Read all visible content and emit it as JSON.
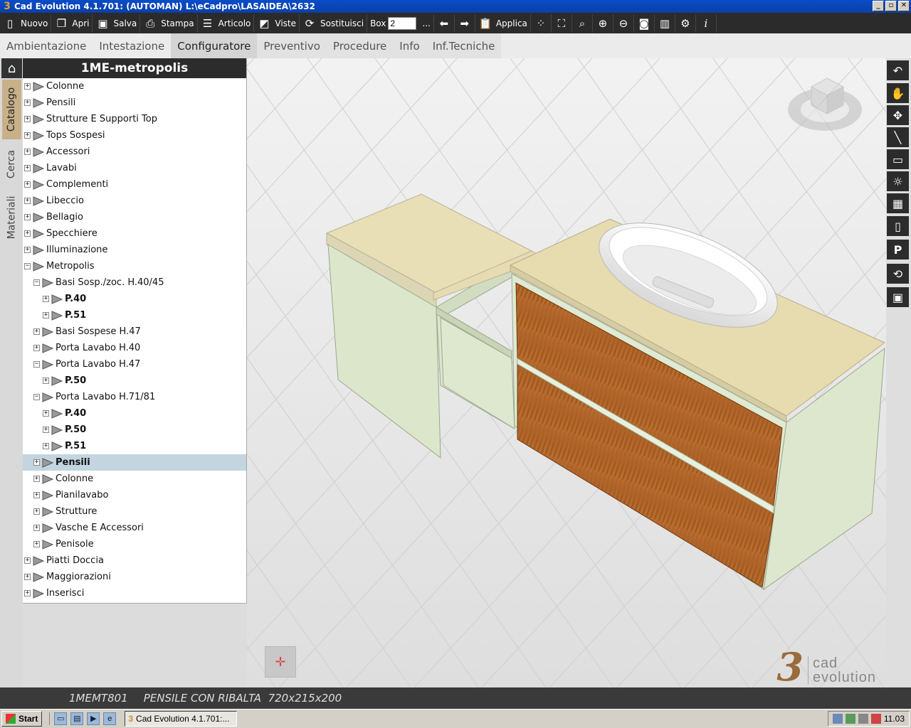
{
  "window": {
    "title": "Cad Evolution 4.1.701: (AUTOMAN)  L:\\eCadpro\\LASAIDEA\\2632",
    "buttons": [
      "_",
      "▫",
      "✕"
    ]
  },
  "toolbar": {
    "nuovo": "Nuovo",
    "apri": "Apri",
    "salva": "Salva",
    "stampa": "Stampa",
    "articolo": "Articolo",
    "viste": "Viste",
    "sostituisci": "Sostituisci",
    "box_label": "Box",
    "box_value": "2",
    "ellipsis": "...",
    "applica": "Applica"
  },
  "tabs": [
    "Ambientazione",
    "Intestazione",
    "Configuratore",
    "Preventivo",
    "Procedure",
    "Info",
    "Inf.Tecniche"
  ],
  "side_tabs": [
    "Catalogo",
    "Cerca",
    "Materiali"
  ],
  "catalog": {
    "title": "1ME-metropolis",
    "nodes": [
      {
        "label": "Colonne",
        "level": 0,
        "expanded": false
      },
      {
        "label": "Pensili",
        "level": 0,
        "expanded": false
      },
      {
        "label": "Strutture E Supporti Top",
        "level": 0,
        "expanded": false
      },
      {
        "label": "Tops Sospesi",
        "level": 0,
        "expanded": false
      },
      {
        "label": "Accessori",
        "level": 0,
        "expanded": false
      },
      {
        "label": "Lavabi",
        "level": 0,
        "expanded": false
      },
      {
        "label": "Complementi",
        "level": 0,
        "expanded": false
      },
      {
        "label": "Libeccio",
        "level": 0,
        "expanded": false
      },
      {
        "label": "Bellagio",
        "level": 0,
        "expanded": false
      },
      {
        "label": "Specchiere",
        "level": 0,
        "expanded": false
      },
      {
        "label": "Illuminazione",
        "level": 0,
        "expanded": false
      },
      {
        "label": "Metropolis",
        "level": 0,
        "expanded": true
      },
      {
        "label": "Basi Sosp./zoc. H.40/45",
        "level": 1,
        "expanded": true
      },
      {
        "label": "P.40",
        "level": 2,
        "expanded": false,
        "bold": true
      },
      {
        "label": "P.51",
        "level": 2,
        "expanded": false,
        "bold": true
      },
      {
        "label": "Basi Sospese H.47",
        "level": 1,
        "expanded": false
      },
      {
        "label": "Porta Lavabo H.40",
        "level": 1,
        "expanded": false
      },
      {
        "label": "Porta Lavabo H.47",
        "level": 1,
        "expanded": true
      },
      {
        "label": "P.50",
        "level": 2,
        "expanded": false,
        "bold": true
      },
      {
        "label": "Porta Lavabo H.71/81",
        "level": 1,
        "expanded": true
      },
      {
        "label": "P.40",
        "level": 2,
        "expanded": false,
        "bold": true
      },
      {
        "label": "P.50",
        "level": 2,
        "expanded": false,
        "bold": true
      },
      {
        "label": "P.51",
        "level": 2,
        "expanded": false,
        "bold": true
      },
      {
        "label": "Pensili",
        "level": 1,
        "expanded": false,
        "selected": true,
        "bold": true
      },
      {
        "label": "Colonne",
        "level": 1,
        "expanded": false
      },
      {
        "label": "Pianilavabo",
        "level": 1,
        "expanded": false
      },
      {
        "label": "Strutture",
        "level": 1,
        "expanded": false
      },
      {
        "label": "Vasche E Accessori",
        "level": 1,
        "expanded": false
      },
      {
        "label": "Penisole",
        "level": 1,
        "expanded": false
      },
      {
        "label": "Piatti Doccia",
        "level": 0,
        "expanded": false
      },
      {
        "label": "Maggiorazioni",
        "level": 0,
        "expanded": false
      },
      {
        "label": "Inserisci",
        "level": 0,
        "expanded": false
      }
    ]
  },
  "right_tools": [
    "undo-icon",
    "pan-hand-icon",
    "move-icon",
    "line-measure-icon",
    "ruler-icon",
    "light-icon",
    "edit-grid-icon",
    "book-icon",
    "p-icon",
    "rotate-icon",
    "screen-icon"
  ],
  "brand": {
    "line1": "cad",
    "line2": "evolution"
  },
  "status": {
    "code": "1MEMT801",
    "description": "PENSILE CON RIBALTA  720x215x200"
  },
  "taskbar": {
    "start": "Start",
    "task": "Cad Evolution 4.1.701:...",
    "clock": "11.03"
  },
  "colors": {
    "selection": "#c2d5e0",
    "dark": "#2c2c2c",
    "wood": "#b86a2a",
    "cabinet": "#dfe8cc",
    "top": "#e6dcb0"
  }
}
